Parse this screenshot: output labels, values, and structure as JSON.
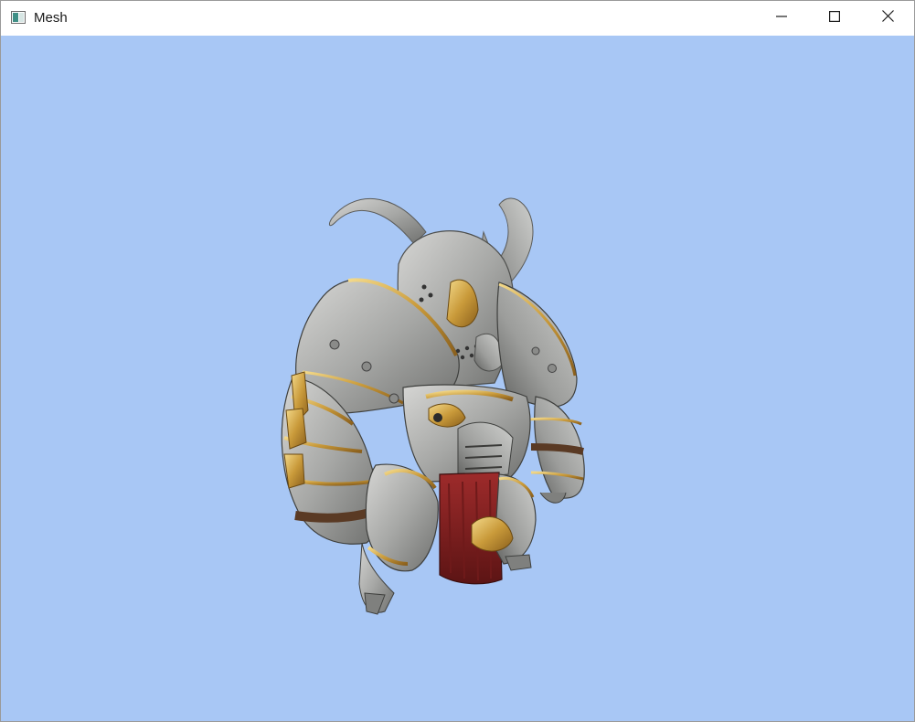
{
  "window": {
    "title": "Mesh",
    "icon": "window-app-icon"
  },
  "caption_buttons": {
    "minimize": "minimize-icon",
    "maximize": "maximize-icon",
    "close": "close-icon"
  },
  "viewport": {
    "background_color": "#a8c7f5",
    "content": "armored-horned-knight-model"
  }
}
